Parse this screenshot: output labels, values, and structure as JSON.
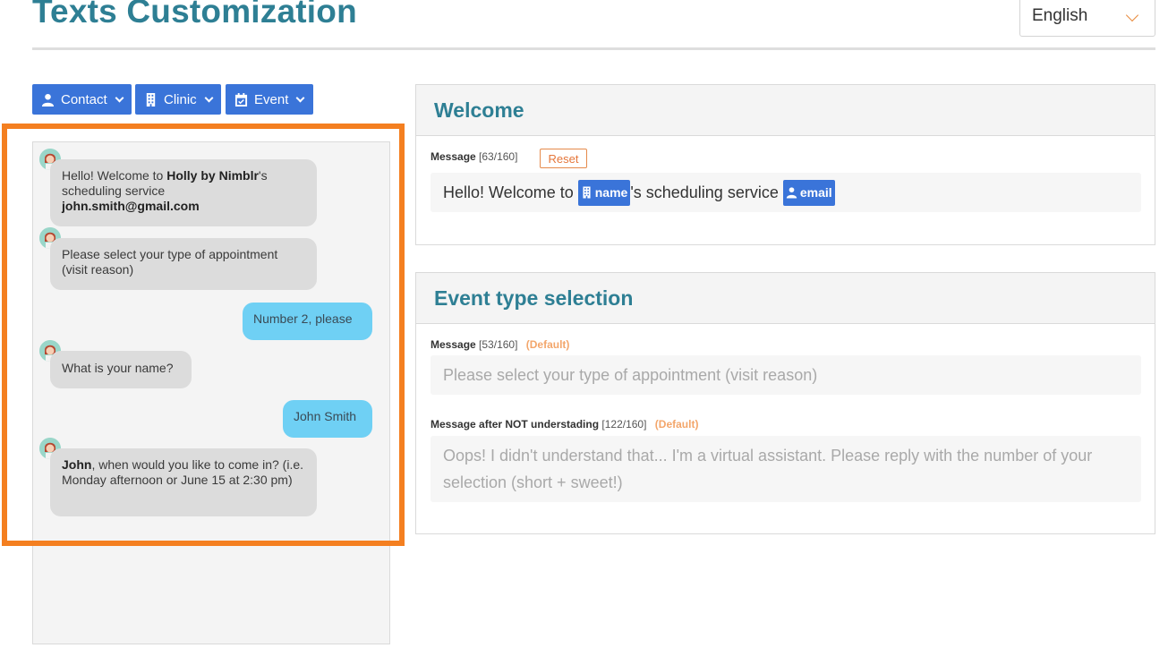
{
  "header": {
    "title": "Texts Customization",
    "language": "English"
  },
  "variables": {
    "contact_label": "Contact",
    "clinic_label": "Clinic",
    "event_label": "Event"
  },
  "chat": {
    "messages": [
      {
        "from": "bot",
        "pre": "Hello! Welcome to ",
        "bold": "Holly by Nimblr",
        "post": "'s scheduling service",
        "line2": "john.smith@gmail.com"
      },
      {
        "from": "bot",
        "text": "Please select your type of appointment (visit reason)"
      },
      {
        "from": "user",
        "text": "Number 2, please"
      },
      {
        "from": "bot",
        "text": "What is your name?"
      },
      {
        "from": "user",
        "text": "John Smith"
      },
      {
        "from": "bot",
        "bold": "John",
        "post": ", when would you like to come in? (i.e. Monday afternoon or June 15 at 2:30 pm)"
      }
    ]
  },
  "welcome": {
    "title": "Welcome",
    "message_label": "Message",
    "message_count": "[63/160]",
    "reset_label": "Reset",
    "text_pre": "Hello! Welcome to ",
    "token_name": "name",
    "text_mid": "'s scheduling service ",
    "token_email": "email"
  },
  "event_selection": {
    "title": "Event type selection",
    "message_label": "Message",
    "message_count": "[53/160]",
    "default_label": "(Default)",
    "message_placeholder": "Please select your type of appointment (visit reason)",
    "not_understood_label": "Message after NOT understading",
    "not_understood_count": "[122/160]",
    "not_understood_default": "(Default)",
    "not_understood_placeholder": "Oops! I didn't understand that... I'm a virtual assistant. Please reply with the number of your selection (short + sweet!)"
  },
  "colors": {
    "title": "#2e7f94",
    "accent_blue": "#3a74d9",
    "highlight": "#f47f20",
    "user_bubble": "#6fd0f4",
    "bot_bubble": "#dcdcdc"
  }
}
